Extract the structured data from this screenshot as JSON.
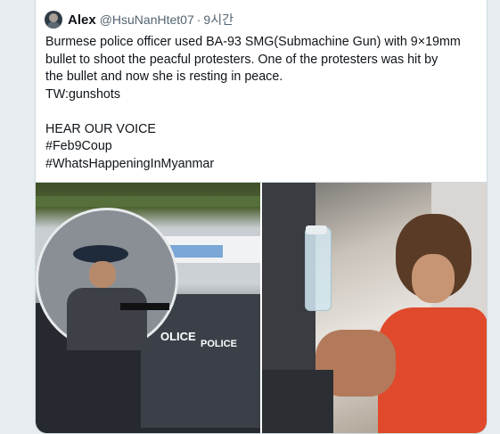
{
  "tweet": {
    "author_name": "Alex",
    "author_handle": "@HsuNanHtet07",
    "separator": "·",
    "timestamp": "9시간",
    "lines": [
      "Burmese police officer used BA-93 SMG(Submachine Gun) with 9×19mm",
      "bullet to shoot the peacful protesters. One of the protesters was hit by",
      "the bullet and now she is resting in peace.",
      "TW:gunshots",
      "",
      "HEAR OUR VOICE",
      "#Feb9Coup",
      "#WhatsHappeningInMyanmar"
    ]
  },
  "media": {
    "photo_1": {
      "shield_text_1": "OLICE",
      "shield_text_2": "POLICE"
    },
    "photo_2": {}
  },
  "colors": {
    "text": "#0f1419",
    "secondary": "#536471",
    "border": "#cfd9de",
    "background": "#e6ecf0"
  }
}
